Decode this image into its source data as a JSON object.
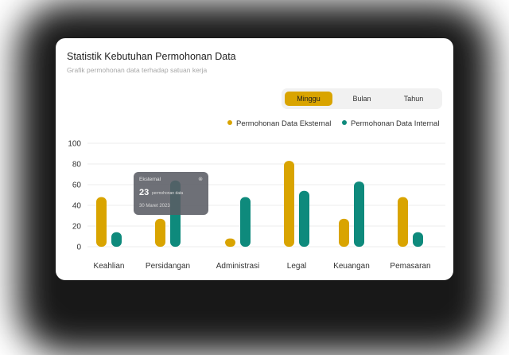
{
  "card": {
    "title": "Statistik Kebutuhan Permohonan Data",
    "subtitle": "Grafik permohonan data terhadap satuan kerja"
  },
  "period_tabs": [
    {
      "label": "Minggu",
      "active": true
    },
    {
      "label": "Bulan",
      "active": false
    },
    {
      "label": "Tahun",
      "active": false
    }
  ],
  "colors": {
    "external": "#d9a400",
    "internal": "#0e8a7c",
    "grid": "#ececec",
    "axis_text": "#333333",
    "tab_active": "#d9a400"
  },
  "tooltip": {
    "label": "Eksternal",
    "close_icon": "close-circle-icon",
    "value": "23",
    "unit": "permohonan data",
    "date": "30 Maret 2023"
  },
  "chart_data": {
    "type": "bar",
    "title": "Statistik Kebutuhan Permohonan Data",
    "subtitle": "Grafik permohonan data terhadap satuan kerja",
    "categories": [
      "Keahlian",
      "Persidangan",
      "Administrasi",
      "Legal",
      "Keuangan",
      "Pemasaran"
    ],
    "series": [
      {
        "name": "Permohonan Data Eksternal",
        "color": "#d9a400",
        "values": [
          48,
          27,
          8,
          83,
          27,
          48
        ]
      },
      {
        "name": "Permohonan Data Internal",
        "color": "#0e8a7c",
        "values": [
          14,
          64,
          48,
          54,
          63,
          14
        ]
      }
    ],
    "yticks": [
      0,
      20,
      40,
      60,
      80,
      100
    ],
    "ylim": [
      0,
      100
    ],
    "grid": true,
    "legend": "top-right"
  }
}
